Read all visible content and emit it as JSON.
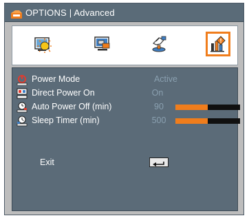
{
  "window": {
    "title": "OPTIONS | Advanced",
    "title_icon": "options-icon"
  },
  "tabs": [
    {
      "name": "image-settings",
      "icon": "image-settings-icon",
      "active": false
    },
    {
      "name": "display",
      "icon": "display-icon",
      "active": false
    },
    {
      "name": "setup",
      "icon": "setup-icon",
      "active": false
    },
    {
      "name": "options",
      "icon": "options-icon",
      "active": true
    }
  ],
  "menu": {
    "items": [
      {
        "label": "Power Mode",
        "icon": "power-mode-icon",
        "value": "Active"
      },
      {
        "label": "Direct Power On",
        "icon": "direct-power-on-icon",
        "value": "On"
      },
      {
        "label": "Auto Power Off (min)",
        "icon": "auto-power-off-icon",
        "value": "90",
        "level": 0.5
      },
      {
        "label": "Sleep Timer (min)",
        "icon": "sleep-timer-icon",
        "value": "500",
        "level": 0.5
      }
    ],
    "exit_label": "Exit",
    "exit_icon": "enter-key-icon"
  },
  "colors": {
    "accent": "#f07d1c",
    "panel": "#5b6b78",
    "frame": "#bdbdbd",
    "value_text": "#8aa0b0"
  }
}
